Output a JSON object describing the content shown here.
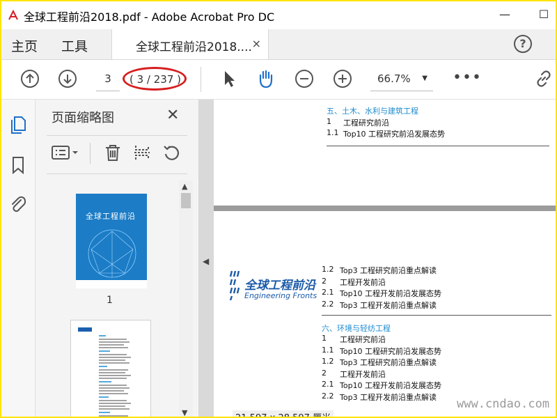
{
  "window": {
    "title": "全球工程前沿2018.pdf - Adobe Acrobat Pro DC",
    "minimize": "—",
    "maximize": "☐"
  },
  "menubar": {
    "home": "主页",
    "tools": "工具",
    "tab_label": "全球工程前沿2018....",
    "tab_close": "×",
    "help": "?"
  },
  "toolbar": {
    "page_current": "3",
    "page_of": "( 3 / 237 )",
    "zoom": "66.7%",
    "zoom_caret": "▼",
    "more": "•••"
  },
  "thumbnail_panel": {
    "title": "页面缩略图",
    "close": "✕",
    "scroll_up": "▲",
    "scroll_down": "▼",
    "thumb1_cover_title": "全球工程前沿",
    "thumb1_label": "1"
  },
  "document": {
    "page_a": [
      {
        "num": "",
        "text": "五、土木、水利与建筑工程",
        "head": true
      },
      {
        "num": "1",
        "text": "工程研究前沿",
        "head": false
      },
      {
        "num": "1.1",
        "text": "Top10 工程研究前沿发展态势",
        "head": false
      }
    ],
    "logo_title": "全球工程前沿",
    "logo_subtitle": "Engineering Fronts",
    "page_b": [
      {
        "num": "1.2",
        "text": "Top3 工程研究前沿重点解读",
        "head": false
      },
      {
        "num": "2",
        "text": "工程开发前沿",
        "head": false
      },
      {
        "num": "2.1",
        "text": "Top10 工程开发前沿发展态势",
        "head": false
      },
      {
        "num": "2.2",
        "text": "Top3 工程开发前沿重点解读",
        "head": false
      },
      {
        "num": "",
        "text": "六、环境与轻纺工程",
        "head": true
      },
      {
        "num": "1",
        "text": "工程研究前沿",
        "head": false
      },
      {
        "num": "1.1",
        "text": "Top10 工程研究前沿发展态势",
        "head": false
      },
      {
        "num": "1.2",
        "text": "Top3 工程研究前沿重点解读",
        "head": false
      },
      {
        "num": "2",
        "text": "工程开发前沿",
        "head": false
      },
      {
        "num": "2.1",
        "text": "Top10 工程开发前沿发展态势",
        "head": false
      },
      {
        "num": "2.2",
        "text": "Top3 工程开发前沿重点解读",
        "head": false
      }
    ],
    "collapse_arrow": "◀",
    "dimensions": "21.597 x 28.597 厘米"
  },
  "watermark": "www.cndao.com",
  "colors": {
    "frame": "#ffe400",
    "accent_blue": "#1c8bd0",
    "highlight_ring": "#d61f1f"
  }
}
